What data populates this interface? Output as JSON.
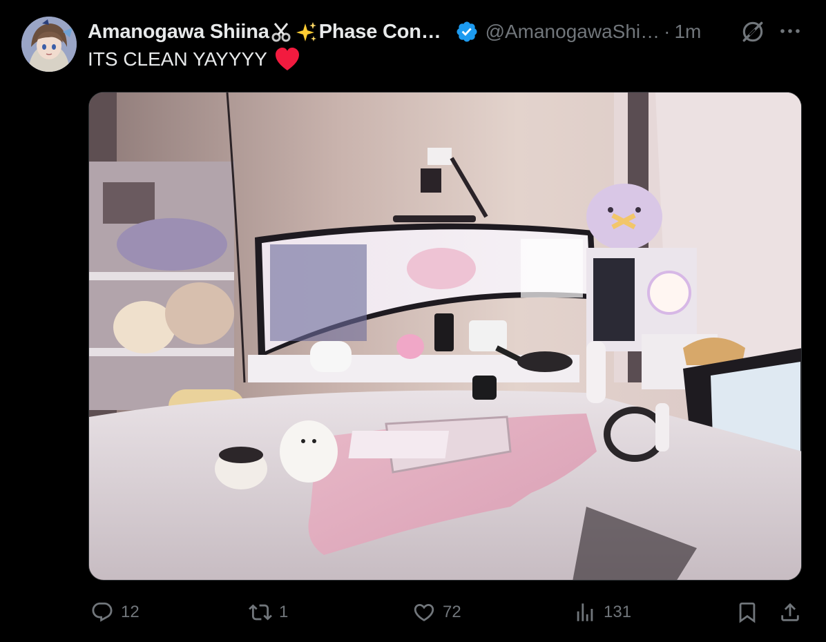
{
  "post": {
    "display_name_part1": "Amanogawa Shiina",
    "display_name_part2": "Phase Con…",
    "handle": "@AmanogawaShi…",
    "separator": "·",
    "time": "1m",
    "text": "ITS CLEAN YAYYYY"
  },
  "metrics": {
    "replies": "12",
    "reposts": "1",
    "likes": "72",
    "views": "131"
  },
  "colors": {
    "verified": "#1d9bf0",
    "heart": "#f21b3f",
    "muted": "#71767b",
    "text": "#e7e9ea",
    "background": "#000000"
  },
  "icons": {
    "verified": "verified-badge-icon",
    "grok": "grok-icon",
    "more": "more-icon",
    "reply": "reply-icon",
    "repost": "repost-icon",
    "like": "like-icon",
    "views": "views-icon",
    "bookmark": "bookmark-icon",
    "share": "share-icon"
  }
}
